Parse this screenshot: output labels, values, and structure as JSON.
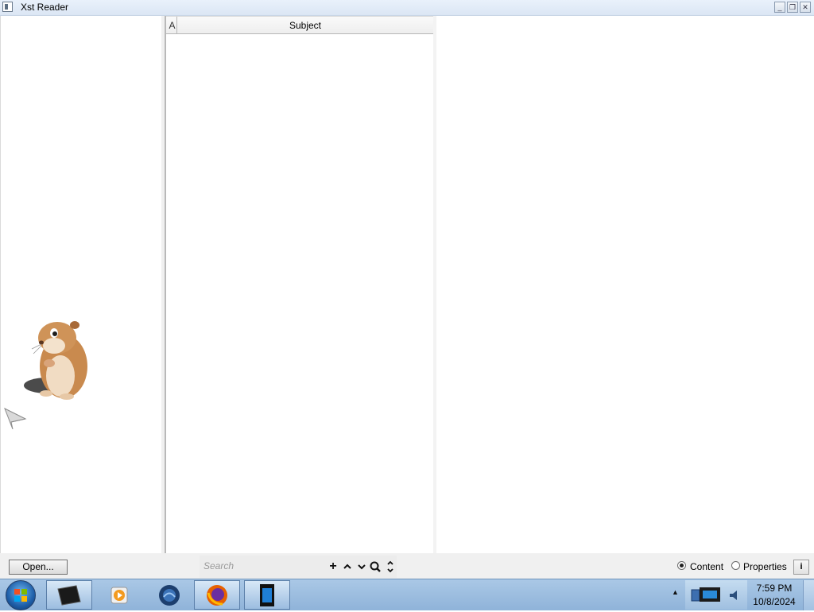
{
  "window": {
    "title": "Xst Reader",
    "controls": {
      "minimize": "_",
      "restore": "❐",
      "close": "✕"
    }
  },
  "message_list": {
    "columns": [
      {
        "label": "A",
        "icon": "attachment-column"
      },
      {
        "label": "Subject"
      }
    ],
    "rows": []
  },
  "toolbar": {
    "open_label": "Open...",
    "search": {
      "placeholder": "Search",
      "value": ""
    },
    "search_buttons": [
      {
        "icon": "plus-icon",
        "glyph": "+"
      },
      {
        "icon": "chevron-up-icon",
        "glyph": "⌃"
      },
      {
        "icon": "chevron-down-icon",
        "glyph": "⌄"
      },
      {
        "icon": "magnifier-icon",
        "glyph": "🔍"
      },
      {
        "icon": "up-down-icon",
        "glyph": "↕"
      }
    ],
    "view_options": [
      {
        "label": "Content",
        "selected": true
      },
      {
        "label": "Properties",
        "selected": false
      }
    ],
    "info_label": "i"
  },
  "taskbar": {
    "apps": [
      {
        "name": "terminal",
        "active": true
      },
      {
        "name": "media-player",
        "active": false
      },
      {
        "name": "thunderbird",
        "active": false
      },
      {
        "name": "firefox",
        "active": false
      },
      {
        "name": "xst-reader",
        "active": true
      }
    ],
    "clock": {
      "time": "7:59 PM",
      "date": "10/8/2024"
    }
  },
  "colors": {
    "titlebar": "#dbe6f4",
    "taskbar": "#8fb3d9",
    "toolbar": "#f0f0f0"
  }
}
